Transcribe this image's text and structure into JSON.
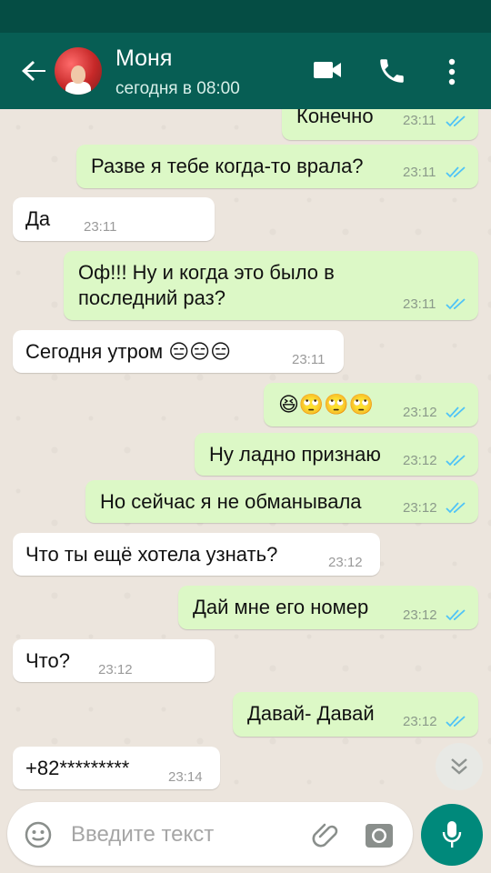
{
  "header": {
    "contact_name": "Моня",
    "last_seen": "сегодня в 08:00"
  },
  "icons": {
    "back": "arrow-left-icon",
    "video": "video-camera-icon",
    "call": "phone-icon",
    "menu": "more-vertical-icon",
    "scroll": "chevron-double-down-icon",
    "emoji": "emoji-icon",
    "attach": "paperclip-icon",
    "camera": "camera-icon",
    "mic": "microphone-icon"
  },
  "colors": {
    "header": "#075e54",
    "outgoing_bubble": "#dcf8c6",
    "incoming_bubble": "#ffffff",
    "read_ticks": "#4fc3f7",
    "mic_button": "#00897b"
  },
  "messages": [
    {
      "dir": "out",
      "text": "Конечно",
      "time": "23:11",
      "read": true
    },
    {
      "dir": "out",
      "text": "Разве я тебе когда-то врала?",
      "time": "23:11",
      "read": true
    },
    {
      "dir": "in",
      "text": "Да",
      "time": "23:11"
    },
    {
      "dir": "out",
      "text": "Оф!!! Ну и когда это было в",
      "text2": "последний раз?",
      "time": "23:11",
      "read": true
    },
    {
      "dir": "in",
      "text": "Сегодня утром 😑😑😑",
      "time": "23:11"
    },
    {
      "dir": "out",
      "text": "😆🙄🙄🙄",
      "time": "23:12",
      "read": true
    },
    {
      "dir": "out",
      "text": "Ну ладно признаю",
      "time": "23:12",
      "read": true
    },
    {
      "dir": "out",
      "text": "Но сейчас я не обманывала",
      "time": "23:12",
      "read": true
    },
    {
      "dir": "in",
      "text": "Что ты ещё хотела узнать?",
      "time": "23:12"
    },
    {
      "dir": "out",
      "text": "Дай мне его номер",
      "time": "23:12",
      "read": true
    },
    {
      "dir": "in",
      "text": "Что?",
      "time": "23:12"
    },
    {
      "dir": "out",
      "text": "Давай- Давай",
      "time": "23:12",
      "read": true
    },
    {
      "dir": "in",
      "text": "+82*********",
      "time": "23:14"
    }
  ],
  "composer": {
    "placeholder": "Введите текст"
  }
}
